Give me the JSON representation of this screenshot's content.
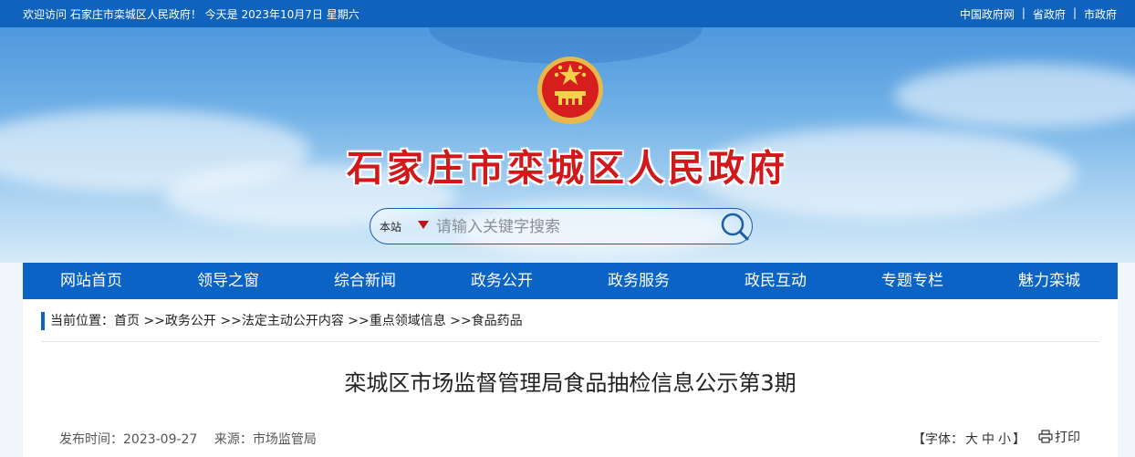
{
  "topbar": {
    "welcome": "欢迎访问 石家庄市栾城区人民政府！ 今天是  2023年10月7日 星期六",
    "links": [
      "中国政府网",
      "省政府",
      "市政府"
    ],
    "separator": "|"
  },
  "header": {
    "site_title": "石家庄市栾城区人民政府",
    "emblem_icon": "national-emblem-icon"
  },
  "search": {
    "scope": "本站",
    "placeholder": "请输入关键字搜索",
    "icon": "search-icon"
  },
  "nav": {
    "items": [
      "网站首页",
      "领导之窗",
      "综合新闻",
      "政务公开",
      "政务服务",
      "政民互动",
      "专题专栏",
      "魅力栾城"
    ]
  },
  "breadcrumb": {
    "label": "当前位置：",
    "items": [
      "首页",
      ">>政务公开",
      ">>法定主动公开内容",
      ">>重点领域信息",
      ">>食品药品"
    ]
  },
  "article": {
    "title": "栾城区市场监督管理局食品抽检信息公示第3期",
    "publish_time": "发布时间：2023-09-27",
    "source": "来源：市场监管局",
    "font_label": "【字体：",
    "font_sizes": [
      "大",
      "中",
      "小"
    ],
    "font_close": "】",
    "print_label": "打印"
  },
  "colors": {
    "topbar": "#0f63bd",
    "nav": "#0b63c5",
    "title_red": "#d1181b"
  }
}
